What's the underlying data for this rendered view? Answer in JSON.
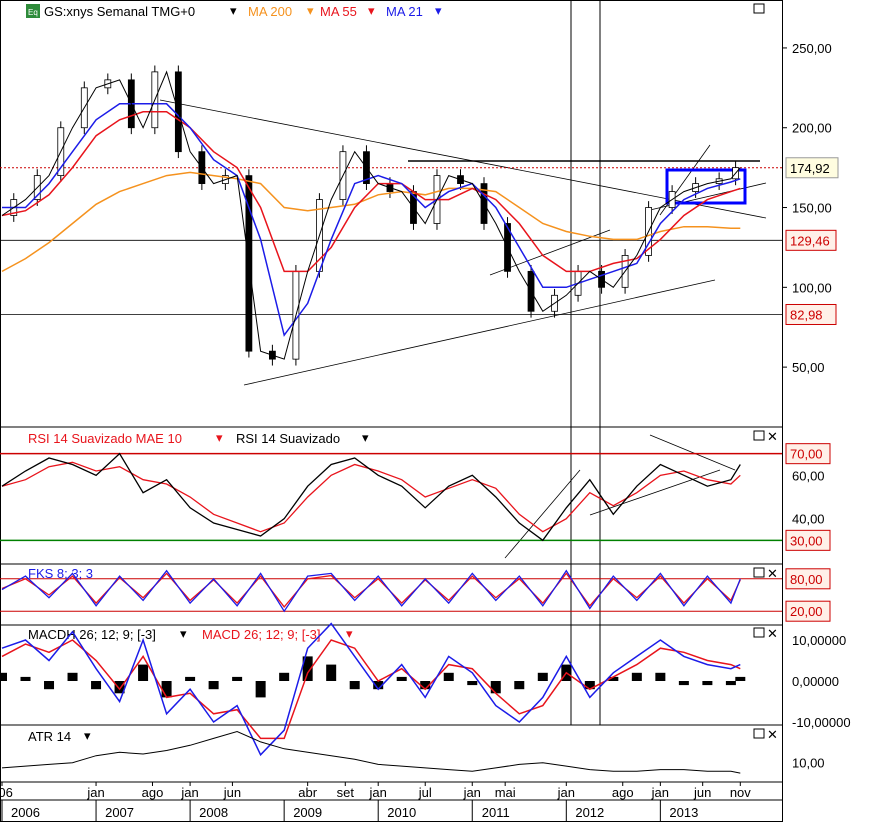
{
  "chart_data": {
    "type": "line",
    "title": "GS:xnys Semanal TMG+0",
    "colors": {
      "price": "#000000",
      "ma200": "#f5921e",
      "ma55": "#e8141c",
      "ma21": "#1c1ce8",
      "up": "#ffffff",
      "down": "#000000",
      "rsi": "#000000",
      "rsi_ma": "#e8141c",
      "stoch_k": "#1c1ce8",
      "stoch_d": "#e8141c",
      "macd": "#1c1ce8",
      "macd_signal": "#e8141c",
      "hist": "#000000",
      "level_red": "#cc0000",
      "level_green": "#008000",
      "box": "#0000ff"
    },
    "legend": [
      {
        "label": "MA 200",
        "color": "#f5921e"
      },
      {
        "label": "MA 55",
        "color": "#e8141c"
      },
      {
        "label": "MA 21",
        "color": "#1c1ce8"
      }
    ],
    "price_panel": {
      "ylim": [
        20,
        265
      ],
      "yticks": [
        50,
        100,
        150,
        200,
        250
      ],
      "ytick_labels": [
        "50,00",
        "100,00",
        "150,00",
        "200,00",
        "250,00"
      ],
      "markers": [
        {
          "value": 174.92,
          "label": "174,92",
          "style": "dotted-red"
        },
        {
          "value": 129.46,
          "label": "129,46",
          "style": "red-box"
        },
        {
          "value": 82.98,
          "label": "82,98",
          "style": "red-box"
        }
      ],
      "ohlc_series": "price",
      "x": [
        2006.0,
        2006.25,
        2006.5,
        2006.75,
        2007.0,
        2007.25,
        2007.5,
        2007.75,
        2008.0,
        2008.25,
        2008.5,
        2008.75,
        2009.0,
        2009.25,
        2009.5,
        2009.75,
        2010.0,
        2010.25,
        2010.5,
        2010.75,
        2011.0,
        2011.25,
        2011.5,
        2011.75,
        2012.0,
        2012.25,
        2012.5,
        2012.75,
        2013.0,
        2013.25,
        2013.5,
        2013.75,
        2013.85
      ],
      "price": [
        145,
        155,
        170,
        200,
        225,
        230,
        200,
        235,
        185,
        165,
        170,
        60,
        55,
        110,
        155,
        185,
        165,
        160,
        140,
        170,
        165,
        140,
        110,
        85,
        95,
        110,
        100,
        120,
        150,
        160,
        165,
        168,
        175
      ],
      "ma21": [
        150,
        150,
        165,
        185,
        205,
        215,
        215,
        215,
        200,
        180,
        170,
        130,
        70,
        90,
        130,
        165,
        170,
        165,
        150,
        160,
        165,
        150,
        125,
        100,
        100,
        105,
        110,
        115,
        140,
        155,
        162,
        166,
        168
      ],
      "ma55": [
        145,
        148,
        158,
        175,
        195,
        205,
        210,
        210,
        200,
        185,
        175,
        150,
        110,
        110,
        125,
        150,
        165,
        165,
        155,
        155,
        162,
        155,
        140,
        120,
        110,
        110,
        115,
        118,
        130,
        145,
        155,
        160,
        162
      ],
      "ma200": [
        110,
        118,
        128,
        140,
        152,
        160,
        165,
        170,
        172,
        170,
        168,
        165,
        150,
        148,
        150,
        152,
        158,
        160,
        158,
        162,
        162,
        160,
        150,
        140,
        135,
        132,
        130,
        130,
        135,
        138,
        138,
        137,
        137
      ]
    },
    "rsi_panel": {
      "label": "RSI 14 Suavizado",
      "ma_label": "RSI 14 Suavizado MAE 10",
      "ylim": [
        20,
        80
      ],
      "levels": [
        {
          "value": 70,
          "label": "70,00"
        },
        {
          "value": 30,
          "label": "30,00"
        }
      ],
      "yticks": [
        40,
        60
      ],
      "ytick_labels": [
        "40,00",
        "60,00"
      ],
      "rsi": [
        55,
        62,
        68,
        65,
        60,
        70,
        52,
        58,
        45,
        38,
        35,
        32,
        40,
        55,
        65,
        68,
        60,
        55,
        45,
        55,
        60,
        50,
        38,
        30,
        45,
        58,
        42,
        55,
        65,
        60,
        55,
        58,
        65
      ],
      "rsi_ma": [
        55,
        58,
        64,
        66,
        62,
        64,
        58,
        56,
        50,
        42,
        38,
        34,
        38,
        50,
        60,
        65,
        62,
        58,
        50,
        54,
        58,
        54,
        42,
        34,
        40,
        52,
        46,
        52,
        60,
        62,
        58,
        56,
        60
      ]
    },
    "stoch_panel": {
      "label": "FKS 8; 3; 3",
      "levels": [
        {
          "value": 80,
          "label": "80,00"
        },
        {
          "value": 20,
          "label": "20,00"
        }
      ],
      "k": [
        60,
        85,
        45,
        90,
        30,
        85,
        40,
        95,
        35,
        80,
        30,
        90,
        20,
        85,
        90,
        40,
        85,
        30,
        80,
        35,
        90,
        40,
        85,
        30,
        95,
        25,
        85,
        40,
        90,
        30,
        85,
        35,
        80
      ],
      "d": [
        62,
        80,
        50,
        85,
        35,
        82,
        45,
        90,
        40,
        78,
        35,
        85,
        28,
        80,
        86,
        45,
        80,
        35,
        78,
        40,
        85,
        45,
        80,
        35,
        90,
        30,
        80,
        45,
        85,
        35,
        80,
        40,
        78
      ]
    },
    "macd_panel": {
      "label": "MACDH 26; 12; 9; [-3]",
      "signal_label": "MACD 26; 12; 9; [-3]",
      "yticks": [
        10,
        0,
        -10
      ],
      "ytick_labels": [
        "10,00000",
        "0,00000",
        "-10,00000"
      ],
      "macd": [
        8,
        10,
        5,
        12,
        3,
        -5,
        10,
        -8,
        -2,
        -10,
        -6,
        -18,
        -12,
        8,
        14,
        6,
        -2,
        4,
        -4,
        6,
        2,
        -6,
        -10,
        -4,
        6,
        -4,
        2,
        6,
        10,
        6,
        4,
        3,
        4
      ],
      "signal": [
        6,
        9,
        7,
        10,
        5,
        -2,
        6,
        -4,
        -3,
        -8,
        -7,
        -14,
        -14,
        2,
        10,
        8,
        0,
        3,
        -2,
        4,
        3,
        -3,
        -8,
        -6,
        2,
        -2,
        1,
        4,
        8,
        7,
        5,
        4,
        3
      ],
      "hist": [
        2,
        1,
        -2,
        2,
        -2,
        -3,
        4,
        -4,
        1,
        -2,
        1,
        -4,
        2,
        6,
        4,
        -2,
        -2,
        1,
        -2,
        2,
        -1,
        -3,
        -2,
        2,
        4,
        -2,
        1,
        2,
        2,
        -1,
        -1,
        -1,
        1
      ]
    },
    "atr_panel": {
      "label": "ATR 14",
      "yticks": [
        10
      ],
      "ytick_labels": [
        "10,00"
      ],
      "atr": [
        7,
        8,
        9,
        10,
        14,
        16,
        15,
        17,
        20,
        24,
        28,
        22,
        18,
        16,
        14,
        12,
        9,
        8,
        7,
        6,
        5,
        7,
        9,
        10,
        8,
        6,
        5,
        5,
        6,
        6,
        5,
        5,
        4
      ]
    },
    "x_axis": {
      "month_labels": [
        {
          "x": 2006.0,
          "label": "006"
        },
        {
          "x": 2007.0,
          "label": "jan"
        },
        {
          "x": 2007.6,
          "label": "ago"
        },
        {
          "x": 2008.0,
          "label": "jan"
        },
        {
          "x": 2008.45,
          "label": "jun"
        },
        {
          "x": 2009.25,
          "label": "abr"
        },
        {
          "x": 2009.65,
          "label": "set"
        },
        {
          "x": 2010.0,
          "label": "jan"
        },
        {
          "x": 2010.5,
          "label": "jul"
        },
        {
          "x": 2011.0,
          "label": "jan"
        },
        {
          "x": 2011.35,
          "label": "mai"
        },
        {
          "x": 2012.0,
          "label": "jan"
        },
        {
          "x": 2012.6,
          "label": "ago"
        },
        {
          "x": 2013.0,
          "label": "jan"
        },
        {
          "x": 2013.45,
          "label": "jun"
        },
        {
          "x": 2013.85,
          "label": "nov"
        }
      ],
      "year_labels": [
        "2006",
        "2007",
        "2008",
        "2009",
        "2010",
        "2011",
        "2012",
        "2013"
      ],
      "year_positions": [
        2006.25,
        2007.25,
        2008.25,
        2009.25,
        2010.25,
        2011.25,
        2012.25,
        2013.25
      ]
    }
  }
}
